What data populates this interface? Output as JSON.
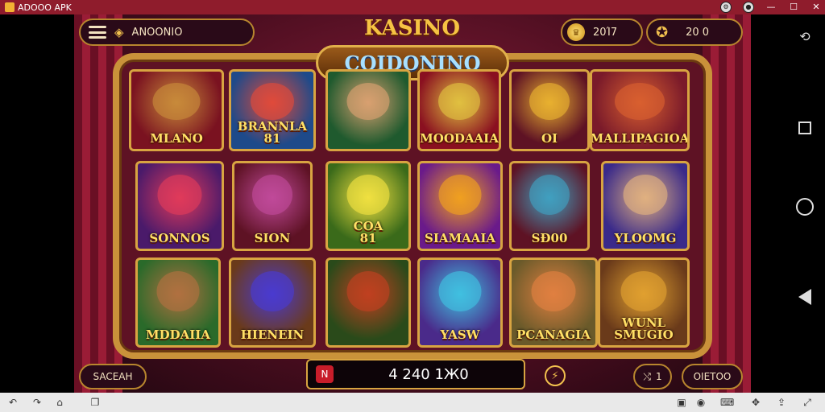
{
  "window": {
    "title": "ADOOO APK"
  },
  "header": {
    "menu_label": "ANOONIO",
    "title": "KASINO",
    "coins": "20Ί7",
    "gems": "20 0"
  },
  "banner": "COIDONINO",
  "tiles": [
    {
      "label": "MLANO",
      "color": "#7a1220",
      "art": "#c88a3a"
    },
    {
      "label": "BRANNLA\n81",
      "color": "#1e4a8a",
      "art": "#e04a3a"
    },
    {
      "label": "",
      "color": "#1f5a2e",
      "art": "#d8a070"
    },
    {
      "label": "MOODAAIA",
      "color": "#8a1020",
      "art": "#e0c040"
    },
    {
      "label": "OI",
      "color": "#5e1224",
      "art": "#e8b030"
    },
    {
      "label": "MALLIPAGIOA",
      "color": "#7a1a2a",
      "art": "#d86030"
    },
    {
      "label": "SONNOS",
      "color": "#4a1a6a",
      "art": "#e03a5a"
    },
    {
      "label": "SION",
      "color": "#5e1224",
      "art": "#c04a9a"
    },
    {
      "label": "COA\n81",
      "color": "#3a6a1a",
      "art": "#f0e040"
    },
    {
      "label": "SIAMAAIA",
      "color": "#6a1a8a",
      "art": "#f0a020"
    },
    {
      "label": "SÐ00",
      "color": "#5e1224",
      "art": "#40a0c0"
    },
    {
      "label": "YLOOMG",
      "color": "#3a2a8a",
      "art": "#e0b080"
    },
    {
      "label": "MDDAIIA",
      "color": "#2a6a2a",
      "art": "#b07040"
    },
    {
      "label": "HIENEIN",
      "color": "#6a3a1a",
      "art": "#4a3ad0"
    },
    {
      "label": "",
      "color": "#2a4a1a",
      "art": "#c04020"
    },
    {
      "label": "YASW",
      "color": "#4a2a8a",
      "art": "#40c0e0"
    },
    {
      "label": "PCANAGIA",
      "color": "#6a5a2a",
      "art": "#e08040"
    },
    {
      "label": "WUNL\nSMUGIO",
      "color": "#6a3a1a",
      "art": "#e0a030"
    }
  ],
  "bottom": {
    "left_button": "SACEAH",
    "balance": "4 240 1Ж0",
    "multiplier": "1",
    "right_button": "OIETOO"
  },
  "colors": {
    "accent_gold": "#d8a441",
    "bg_red": "#5e1224"
  }
}
